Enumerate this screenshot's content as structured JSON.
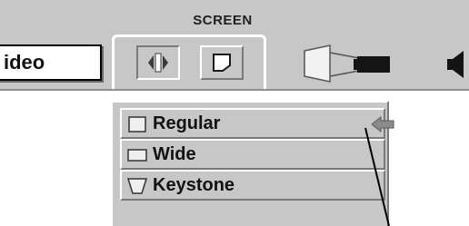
{
  "header": {
    "title": "SCREEN",
    "input_value": "ideo"
  },
  "toolbar": {
    "buttons": [
      {
        "icon": "screen-mode-icon",
        "state": "pressed"
      },
      {
        "icon": "keystone-icon",
        "state": "normal"
      }
    ],
    "extra_icons": [
      "projector-icon",
      "speaker-icon"
    ]
  },
  "screen_menu": {
    "items": [
      {
        "label": "Regular",
        "icon": "regular-screen-icon",
        "selected": true
      },
      {
        "label": "Wide",
        "icon": "wide-screen-icon",
        "selected": false
      },
      {
        "label": "Keystone",
        "icon": "keystone-screen-icon",
        "selected": false
      }
    ]
  },
  "colors": {
    "menu_bg": "#c7c7c7",
    "highlight": "#ffffff",
    "shadow": "#7a7a7a",
    "arrow": "#8a8a8a",
    "text": "#121212"
  }
}
